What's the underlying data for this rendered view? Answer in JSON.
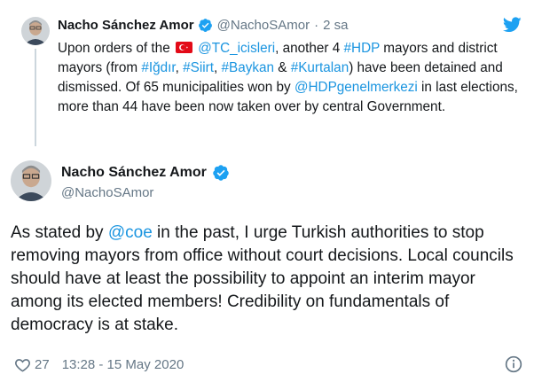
{
  "parent": {
    "name": "Nacho Sánchez Amor",
    "handle": "@NachoSAmor",
    "separator": "·",
    "time": "2 sa",
    "text_1": "Upon orders of the ",
    "mention_1": "@TC_icisleri",
    "text_2": ", another 4 ",
    "hashtag_1": "#HDP",
    "text_3": " mayors and district mayors (from ",
    "hashtag_2": "#Iğdır",
    "text_4": ", ",
    "hashtag_3": "#Siirt",
    "text_5": ", ",
    "hashtag_4": "#Baykan",
    "text_6": " & ",
    "hashtag_5": "#Kurtalan",
    "text_7": ") have been detained and dismissed. Of 65 municipalities won by ",
    "mention_2": "@HDPgenelmerkezi",
    "text_8": " in last elections, more than 44 have been now taken over by central Government."
  },
  "main": {
    "name": "Nacho Sánchez Amor",
    "handle": "@NachoSAmor",
    "text_1": "As stated by ",
    "mention_1": "@coe",
    "text_2": " in the past, I urge Turkish authorities to stop removing mayors from office without court decisions. Local councils should have at least the possibility to appoint an interim mayor among its elected members! Credibility on fundamentals of democracy is at stake."
  },
  "footer": {
    "likes": "27",
    "timestamp": "13:28 - 15 May 2020"
  },
  "icons": {
    "verified": "verified-badge-icon",
    "twitter": "twitter-bird-icon",
    "heart": "heart-icon",
    "info": "info-icon",
    "flag": "turkey-flag-icon"
  },
  "colors": {
    "link": "#1b95e0",
    "verified": "#1da1f2",
    "muted": "#657786",
    "flag_red": "#e30a17"
  }
}
